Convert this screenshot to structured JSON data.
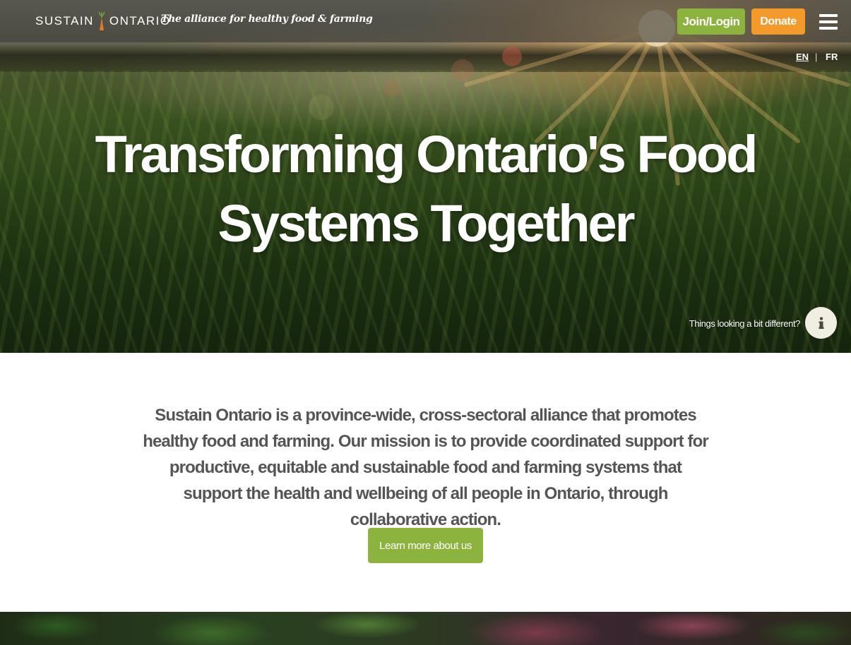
{
  "header": {
    "logo_left": "SUSTAIN",
    "logo_right": "ONTARIO",
    "tagline": "The alliance for healthy food & farming",
    "join_label": "Join/Login",
    "donate_label": "Donate",
    "menu_icon": "hamburger-menu-icon"
  },
  "language": {
    "en": "EN",
    "separator": "|",
    "fr": "FR",
    "active": "EN"
  },
  "hero": {
    "title": "Transforming Ontario's Food Systems Together",
    "info_text": "Things looking a bit different?",
    "info_icon": "info-icon"
  },
  "intro": {
    "text": "Sustain Ontario is a province-wide, cross-sectoral alliance that promotes healthy food and farming. Our mission is to provide coordinated support for productive, equitable and sustainable food and farming systems that support the health and wellbeing of all people in Ontario, through collaborative action.",
    "button_label": "Learn more about us"
  },
  "colors": {
    "green_accent": "#8db33f",
    "orange_accent": "#f39a2b",
    "body_text": "#555555"
  }
}
